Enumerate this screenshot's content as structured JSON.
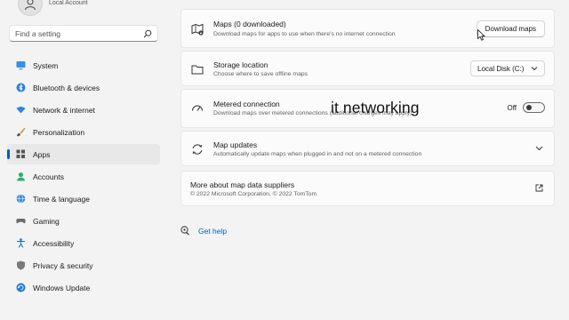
{
  "account": {
    "subtitle": "Local Account"
  },
  "search": {
    "placeholder": "Find a setting"
  },
  "nav": {
    "items": [
      {
        "label": "System",
        "icon": "system-icon"
      },
      {
        "label": "Bluetooth & devices",
        "icon": "bluetooth-icon"
      },
      {
        "label": "Network & internet",
        "icon": "wifi-icon"
      },
      {
        "label": "Personalization",
        "icon": "brush-icon"
      },
      {
        "label": "Apps",
        "icon": "apps-icon",
        "active": true
      },
      {
        "label": "Accounts",
        "icon": "accounts-icon"
      },
      {
        "label": "Time & language",
        "icon": "globe-icon"
      },
      {
        "label": "Gaming",
        "icon": "gaming-icon"
      },
      {
        "label": "Accessibility",
        "icon": "accessibility-icon"
      },
      {
        "label": "Privacy & security",
        "icon": "shield-icon"
      },
      {
        "label": "Windows Update",
        "icon": "update-icon"
      }
    ]
  },
  "maps": {
    "title": "Maps (0 downloaded)",
    "description": "Download maps for apps to use when there's no internet connection",
    "button": "Download maps"
  },
  "storage": {
    "title": "Storage location",
    "description": "Choose where to save offline maps",
    "value": "Local Disk (C:)"
  },
  "metered": {
    "title": "Metered connection",
    "description": "Download maps over metered connections (additional charges may apply)",
    "state": "Off"
  },
  "updates": {
    "title": "Map updates",
    "description": "Automatically update maps when plugged in and not on a metered connection"
  },
  "suppliers": {
    "title": "More about map data suppliers",
    "description": "© 2022 Microsoft Corporation, © 2022 TomTom"
  },
  "overlay_text": "it networking",
  "help": {
    "label": "Get help"
  },
  "colors": {
    "accent": "#005fb8",
    "background": "#f3f3f3",
    "card": "#fbfbfb"
  }
}
